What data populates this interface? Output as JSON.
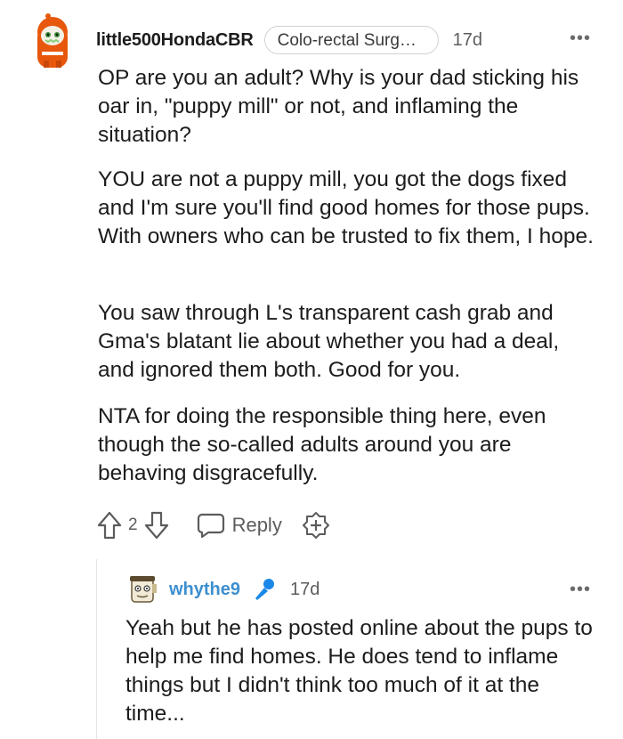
{
  "comment": {
    "username": "little500HondaCBR",
    "flair": "Colo-rectal Surgeo...",
    "time": "17d",
    "more_label": "•••",
    "paragraphs": [
      "OP are you an adult? Why is your dad sticking his oar in, \"puppy mill\" or not, and inflaming the situation?",
      "YOU are not a puppy mill, you got the dogs fixed and I'm sure you'll find good homes for those pups. With owners who can be trusted to fix them, I hope.",
      "You saw through L's transparent cash grab and Gma's blatant lie about whether you had a deal, and ignored them both. Good for you.",
      "NTA for doing the responsible thing here, even though the so-called adults around you are behaving disgracefully."
    ],
    "vote_count": "2",
    "reply_label": "Reply"
  },
  "reply": {
    "username": "whythe9",
    "time": "17d",
    "more_label": "•••",
    "text": "Yeah but he has posted online about the pups to help me find homes. He does tend to inflame things but I didn't think too much of it at the time..."
  },
  "colors": {
    "text": "#1c1c1c",
    "meta": "#5c5c5c",
    "reply_user": "#3d8fd0",
    "avatar_main": "#e8580c",
    "mod_icon": "#1a88e8"
  },
  "icons": [
    "snoo-avatar",
    "more-icon",
    "upvote-icon",
    "downvote-icon",
    "reply-icon",
    "award-icon",
    "microphone-icon"
  ]
}
